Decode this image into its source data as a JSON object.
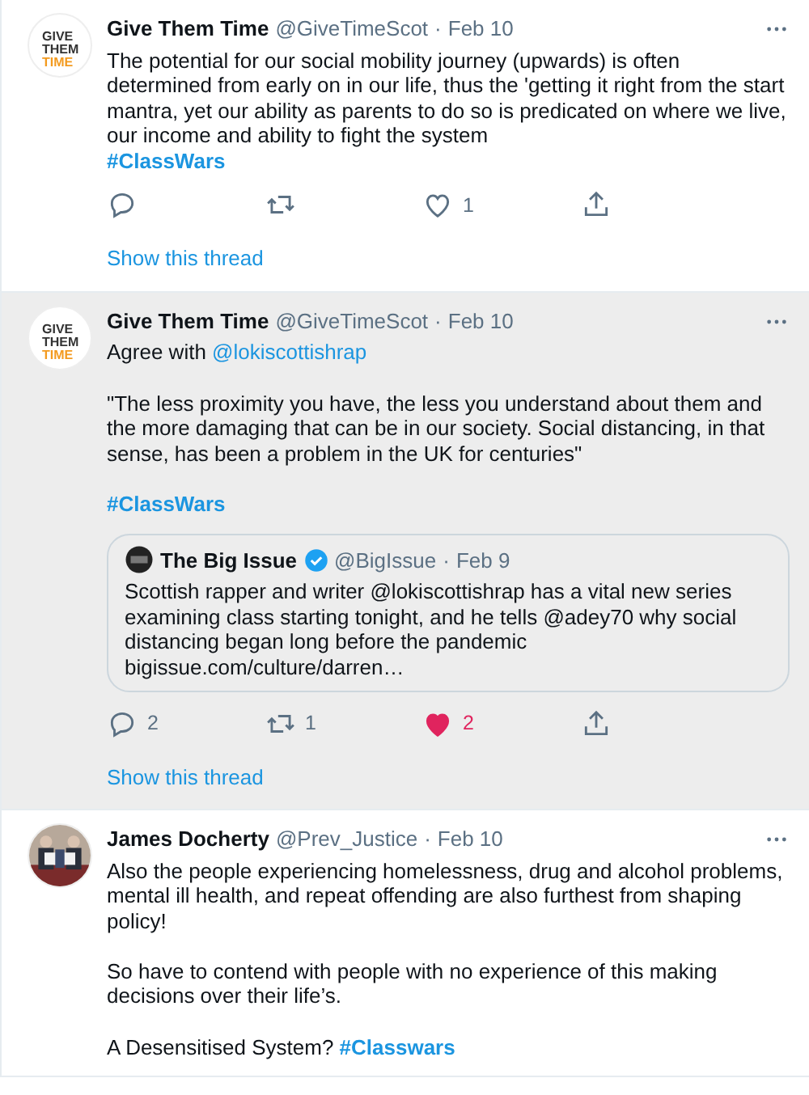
{
  "tweets": [
    {
      "name": "Give Them Time",
      "handle": "@GiveTimeScot",
      "separator": "·",
      "date": "Feb 10",
      "hovered": false,
      "avatar": {
        "kind": "logo",
        "lines": [
          "GIVE",
          "THEM",
          "TIME"
        ]
      },
      "body": [
        {
          "kind": "text",
          "text": "The potential for our social mobility journey (upwards) is often determined from early on in our life, thus the 'getting it right from the start mantra, yet our ability as parents to do so is predicated on where we live, our income and ability to fight the system\n"
        },
        {
          "kind": "hashtag",
          "text": "#ClassWars"
        }
      ],
      "actions": [
        {
          "kind": "reply",
          "active": false
        },
        {
          "kind": "retweet",
          "active": false
        },
        {
          "kind": "like",
          "count": "1",
          "active": false
        },
        {
          "kind": "share",
          "active": false
        }
      ],
      "thread_link": "Show this thread"
    },
    {
      "name": "Give Them Time",
      "handle": "@GiveTimeScot",
      "separator": "·",
      "date": "Feb 10",
      "hovered": true,
      "avatar": {
        "kind": "logo",
        "lines": [
          "GIVE",
          "THEM",
          "TIME"
        ]
      },
      "body": [
        {
          "kind": "text",
          "text": "Agree with "
        },
        {
          "kind": "mention",
          "text": "@lokiscottishrap"
        },
        {
          "kind": "text",
          "text": "\n\n\"The less proximity you have, the less you understand about them and the more damaging that can be in our society. Social distancing, in that sense, has been a problem in the UK for centuries\"\n\n"
        },
        {
          "kind": "hashtag",
          "text": "#ClassWars"
        }
      ],
      "quote": {
        "name": "The Big Issue",
        "verified": true,
        "handle": "@BigIssue",
        "separator": "·",
        "date": "Feb 9",
        "text": "Scottish rapper and writer @lokiscottishrap has a vital new series examining class starting tonight, and he tells @adey70 why social distancing began long before the pandemic\nbigissue.com/culture/darren…"
      },
      "actions": [
        {
          "kind": "reply",
          "count": "2",
          "active": false
        },
        {
          "kind": "retweet",
          "count": "1",
          "active": false
        },
        {
          "kind": "like",
          "count": "2",
          "active": true
        },
        {
          "kind": "share",
          "active": false
        }
      ],
      "thread_link": "Show this thread"
    },
    {
      "name": "James Docherty",
      "handle": "@Prev_Justice",
      "separator": "·",
      "date": "Feb 10",
      "hovered": false,
      "avatar": {
        "kind": "picture"
      },
      "body": [
        {
          "kind": "text",
          "text": "Also the people experiencing homelessness, drug and alcohol problems, mental ill health, and repeat offending are also furthest from shaping policy!\n\nSo have to contend with people with no experience of this making decisions over their life’s.\n\nA Desensitised System? "
        },
        {
          "kind": "hashtag",
          "text": "#Classwars"
        }
      ]
    }
  ]
}
